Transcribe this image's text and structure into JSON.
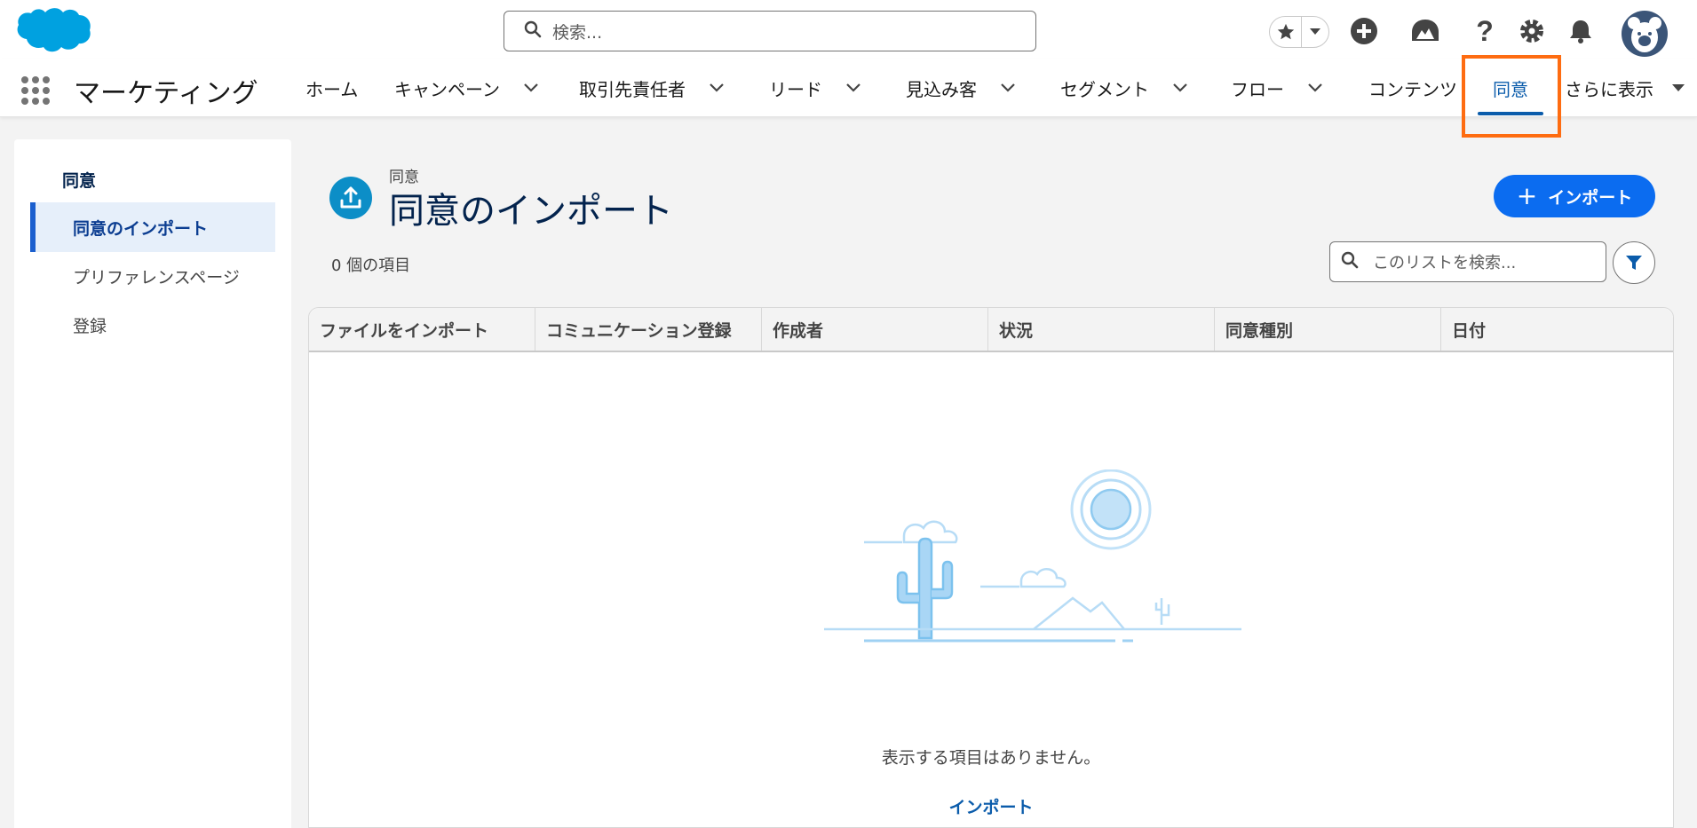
{
  "header": {
    "search_placeholder": "検索...",
    "icons": [
      "favorites-star-icon",
      "chevron-down-icon",
      "add-icon",
      "trailhead-icon",
      "help-icon",
      "setup-gear-icon",
      "notification-bell-icon"
    ],
    "avatar": "bear-avatar"
  },
  "nav": {
    "app_name": "マーケティング",
    "items": [
      {
        "label": "ホーム",
        "has_menu": false
      },
      {
        "label": "キャンペーン",
        "has_menu": true
      },
      {
        "label": "取引先責任者",
        "has_menu": true
      },
      {
        "label": "リード",
        "has_menu": true
      },
      {
        "label": "見込み客",
        "has_menu": true
      },
      {
        "label": "セグメント",
        "has_menu": true
      },
      {
        "label": "フロー",
        "has_menu": true
      },
      {
        "label": "コンテンツ",
        "has_menu": false
      },
      {
        "label": "同意",
        "has_menu": false,
        "active": true
      },
      {
        "label": "さらに表示",
        "has_menu": true
      }
    ]
  },
  "sidebar": {
    "title": "同意",
    "items": [
      {
        "label": "同意のインポート",
        "active": true
      },
      {
        "label": "プリファレンスページ",
        "active": false
      },
      {
        "label": "登録",
        "active": false
      }
    ]
  },
  "main": {
    "breadcrumb": "同意",
    "title": "同意のインポート",
    "item_count": "0 個の項目",
    "import_button": "インポート",
    "list_search_placeholder": "このリストを検索...",
    "columns": [
      "ファイルをインポート",
      "コミュニケーション登録",
      "作成者",
      "状況",
      "同意種別",
      "日付"
    ],
    "empty_message": "表示する項目はありません。",
    "empty_link": "インポート"
  },
  "colors": {
    "brand_blue": "#0b6cf0",
    "active_nav": "#0b5cab",
    "highlight_box": "#fe6c11",
    "page_icon": "#0c8ec7"
  }
}
